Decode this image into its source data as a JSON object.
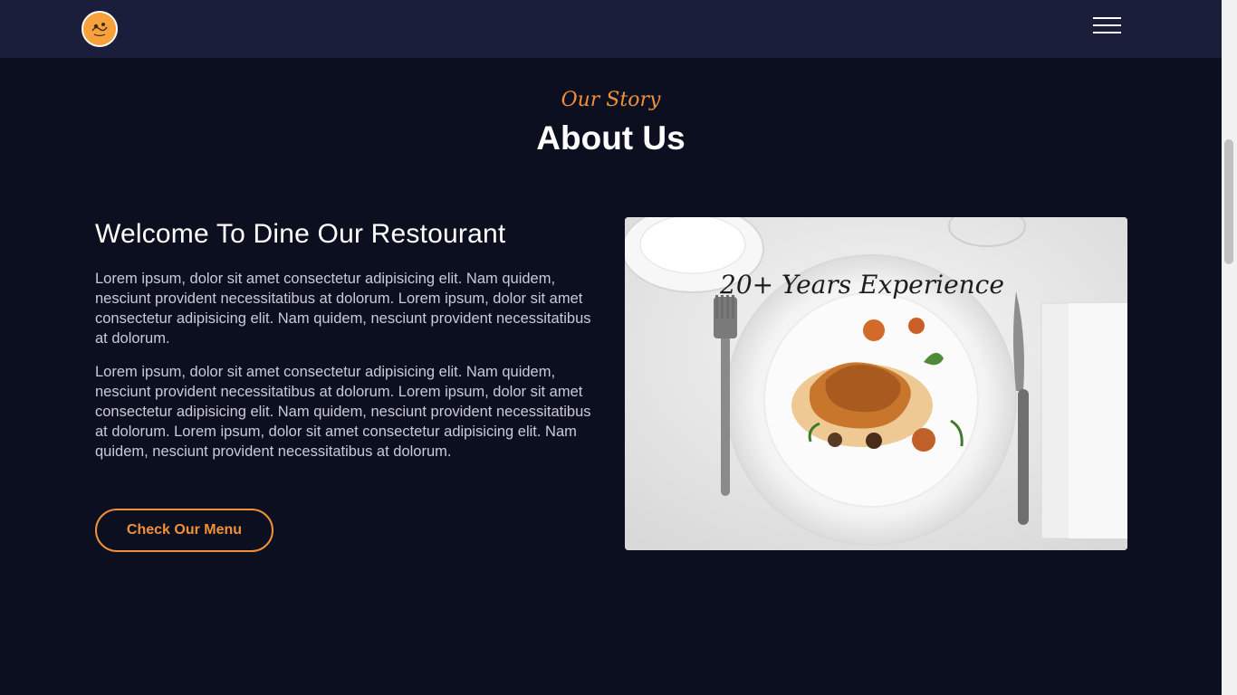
{
  "header": {
    "logo_icon": "chef-logo-icon",
    "menu_icon": "hamburger-menu-icon"
  },
  "about": {
    "eyebrow": "Our Story",
    "title": "About Us",
    "heading": "Welcome To Dine Our Restourant",
    "paragraphs": [
      "Lorem ipsum, dolor sit amet consectetur adipisicing elit. Nam quidem, nesciunt provident necessitatibus at dolorum. Lorem ipsum, dolor sit amet consectetur adipisicing elit. Nam quidem, nesciunt provident necessitatibus at dolorum.",
      "Lorem ipsum, dolor sit amet consectetur adipisicing elit. Nam quidem, nesciunt provident necessitatibus at dolorum. Lorem ipsum, dolor sit amet consectetur adipisicing elit. Nam quidem, nesciunt provident necessitatibus at dolorum. Lorem ipsum, dolor sit amet consectetur adipisicing elit. Nam quidem, nesciunt provident necessitatibus at dolorum."
    ],
    "button_label": "Check Our Menu",
    "image_caption": "20+ Years Experience"
  },
  "colors": {
    "accent": "#f0913a",
    "navbar": "#1a1e3a",
    "background": "#0c0f1f"
  }
}
